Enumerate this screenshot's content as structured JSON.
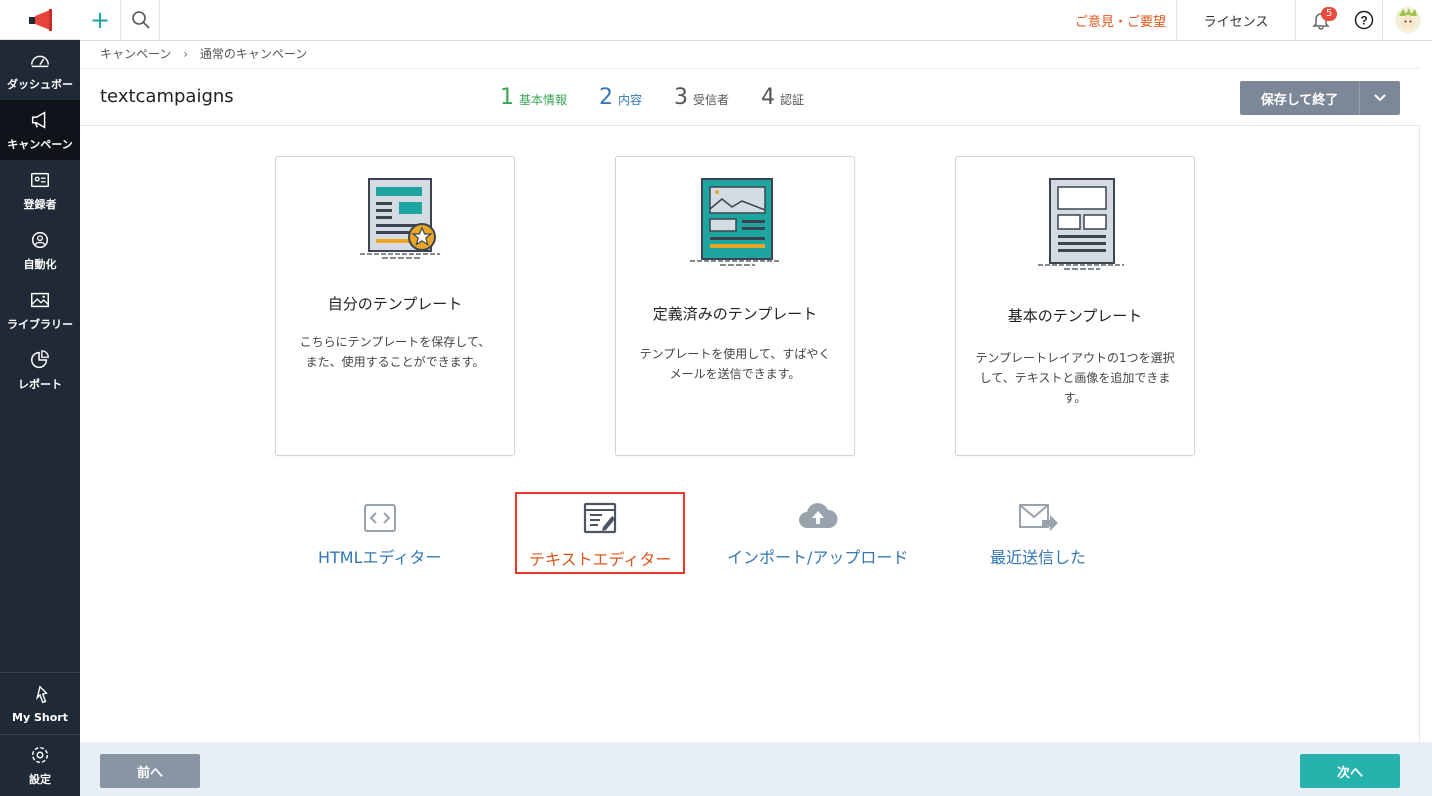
{
  "sidebar": {
    "items": [
      {
        "label": "ダッシュボー",
        "icon": "dashboard-icon",
        "active": false
      },
      {
        "label": "キャンペーン",
        "icon": "megaphone-icon",
        "active": true
      },
      {
        "label": "登録者",
        "icon": "contacts-icon",
        "active": false
      },
      {
        "label": "自動化",
        "icon": "automation-icon",
        "active": false
      },
      {
        "label": "ライブラリー",
        "icon": "library-icon",
        "active": false
      },
      {
        "label": "レポート",
        "icon": "report-icon",
        "active": false
      }
    ],
    "bottom": [
      {
        "label": "My Short",
        "icon": "shortcut-icon"
      },
      {
        "label": "設定",
        "icon": "settings-icon"
      }
    ]
  },
  "topbar": {
    "feedback": "ご意見・ご要望",
    "license": "ライセンス",
    "notifications_count": "5"
  },
  "breadcrumb": {
    "root": "キャンペーン",
    "current": "通常のキャンペーン"
  },
  "campaign": {
    "name": "textcampaigns"
  },
  "steps": [
    {
      "num": "1",
      "label": "基本情報",
      "color": "#3aa655"
    },
    {
      "num": "2",
      "label": "内容",
      "color": "#3377b7"
    },
    {
      "num": "3",
      "label": "受信者",
      "color": "#555555"
    },
    {
      "num": "4",
      "label": "認証",
      "color": "#555555"
    }
  ],
  "save_button": "保存して終了",
  "cards": [
    {
      "title": "自分のテンプレート",
      "desc": "こちらにテンプレートを保存して、また、使用することができます。"
    },
    {
      "title": "定義済みのテンプレート",
      "desc": "テンプレートを使用して、すばやくメールを送信できます。"
    },
    {
      "title": "基本のテンプレート",
      "desc": "テンプレートレイアウトの1つを選択して、テキストと画像を追加できます。"
    }
  ],
  "options": [
    {
      "label": "HTMLエディター",
      "icon": "code-icon"
    },
    {
      "label": "テキストエディター",
      "icon": "text-editor-icon",
      "selected": true
    },
    {
      "label": "インポート/アップロード",
      "icon": "cloud-upload-icon"
    },
    {
      "label": "最近送信した",
      "icon": "mail-forward-icon"
    }
  ],
  "footer": {
    "prev": "前へ",
    "next": "次へ"
  }
}
